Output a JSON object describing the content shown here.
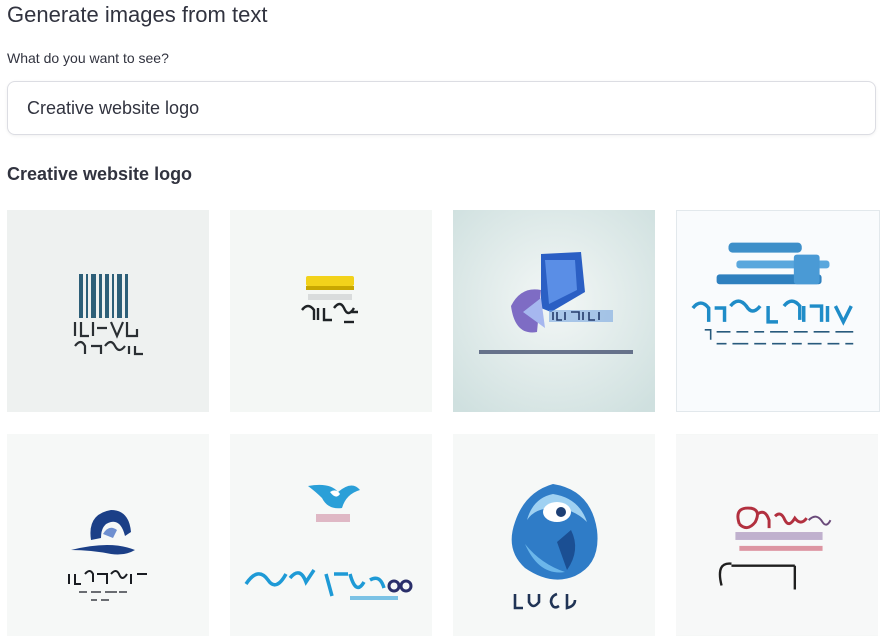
{
  "header": {
    "title": "Generate images from text"
  },
  "prompt": {
    "label": "What do you want to see?",
    "value": "Creative website logo"
  },
  "results": {
    "title": "Creative website logo"
  }
}
